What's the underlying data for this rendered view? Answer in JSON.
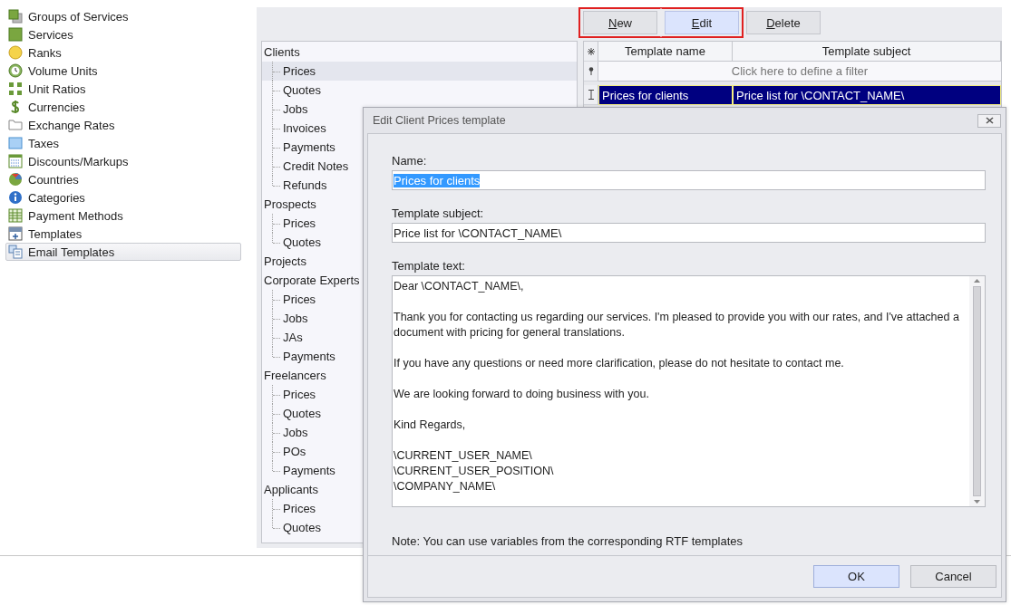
{
  "sidebar": {
    "items": [
      {
        "label": "Groups of Services",
        "selected": false
      },
      {
        "label": "Services",
        "selected": false
      },
      {
        "label": "Ranks",
        "selected": false
      },
      {
        "label": "Volume Units",
        "selected": false
      },
      {
        "label": "Unit Ratios",
        "selected": false
      },
      {
        "label": "Currencies",
        "selected": false
      },
      {
        "label": "Exchange Rates",
        "selected": false
      },
      {
        "label": "Taxes",
        "selected": false
      },
      {
        "label": "Discounts/Markups",
        "selected": false
      },
      {
        "label": "Countries",
        "selected": false
      },
      {
        "label": "Categories",
        "selected": false
      },
      {
        "label": "Payment Methods",
        "selected": false
      },
      {
        "label": "Templates",
        "selected": false
      },
      {
        "label": "Email Templates",
        "selected": true
      }
    ]
  },
  "toolbar": {
    "buttons": [
      {
        "label": "New",
        "mnemonic": true,
        "active": false,
        "highlighted": true
      },
      {
        "label": "Edit",
        "mnemonic": true,
        "active": true,
        "highlighted": true
      },
      {
        "label": "Delete",
        "mnemonic": true,
        "active": false,
        "highlighted": false
      }
    ]
  },
  "tree": [
    {
      "label": "Clients",
      "selected": false,
      "children": [
        {
          "label": "Prices",
          "selected": true
        },
        {
          "label": "Quotes",
          "selected": false
        },
        {
          "label": "Jobs",
          "selected": false
        },
        {
          "label": "Invoices",
          "selected": false
        },
        {
          "label": "Payments",
          "selected": false
        },
        {
          "label": "Credit Notes",
          "selected": false
        },
        {
          "label": "Refunds",
          "selected": false
        }
      ]
    },
    {
      "label": "Prospects",
      "selected": false,
      "children": [
        {
          "label": "Prices",
          "selected": false
        },
        {
          "label": "Quotes",
          "selected": false
        }
      ]
    },
    {
      "label": "Projects",
      "selected": false
    },
    {
      "label": "Corporate Experts",
      "selected": false,
      "children": [
        {
          "label": "Prices",
          "selected": false
        },
        {
          "label": "Jobs",
          "selected": false
        },
        {
          "label": "JAs",
          "selected": false
        },
        {
          "label": "Payments",
          "selected": false
        }
      ]
    },
    {
      "label": "Freelancers",
      "selected": false,
      "children": [
        {
          "label": "Prices",
          "selected": false
        },
        {
          "label": "Quotes",
          "selected": false
        },
        {
          "label": "Jobs",
          "selected": false
        },
        {
          "label": "POs",
          "selected": false
        },
        {
          "label": "Payments",
          "selected": false
        }
      ]
    },
    {
      "label": "Applicants",
      "selected": false,
      "children": [
        {
          "label": "Prices",
          "selected": false
        },
        {
          "label": "Quotes",
          "selected": false
        }
      ]
    }
  ],
  "table": {
    "columns": [
      "Template name",
      "Template subject"
    ],
    "filter": {
      "placeholder": "Click here to define a filter"
    },
    "rows": [
      {
        "cells": [
          "Prices for clients",
          "Price list for \\CONTACT_NAME\\"
        ],
        "selected": true
      }
    ]
  },
  "dialog": {
    "title": "Edit Client Prices template",
    "fields": [
      {
        "kind": "line",
        "label": "Name:",
        "value": "Prices for clients",
        "text_selected": true
      },
      {
        "kind": "line",
        "label": "Template subject:",
        "value": "Price list for \\CONTACT_NAME\\",
        "text_selected": false
      },
      {
        "kind": "multiline",
        "label": "Template text:",
        "value": "Dear \\CONTACT_NAME\\,\n\nThank you for contacting us regarding our services. I'm pleased to provide you with our rates, and I've attached a document with pricing for general translations.\n\nIf you have any questions or need more clarification, please do not hesitate to contact me.\n\nWe are looking forward to doing business with you.\n\nKind Regards,\n\n\\CURRENT_USER_NAME\\\n\\CURRENT_USER_POSITION\\\n\\COMPANY_NAME\\",
        "text_selected": false
      }
    ],
    "note": "Note: You can use variables from the corresponding RTF templates",
    "buttons": [
      {
        "label": "OK",
        "default": true
      },
      {
        "label": "Cancel",
        "default": false
      }
    ]
  }
}
